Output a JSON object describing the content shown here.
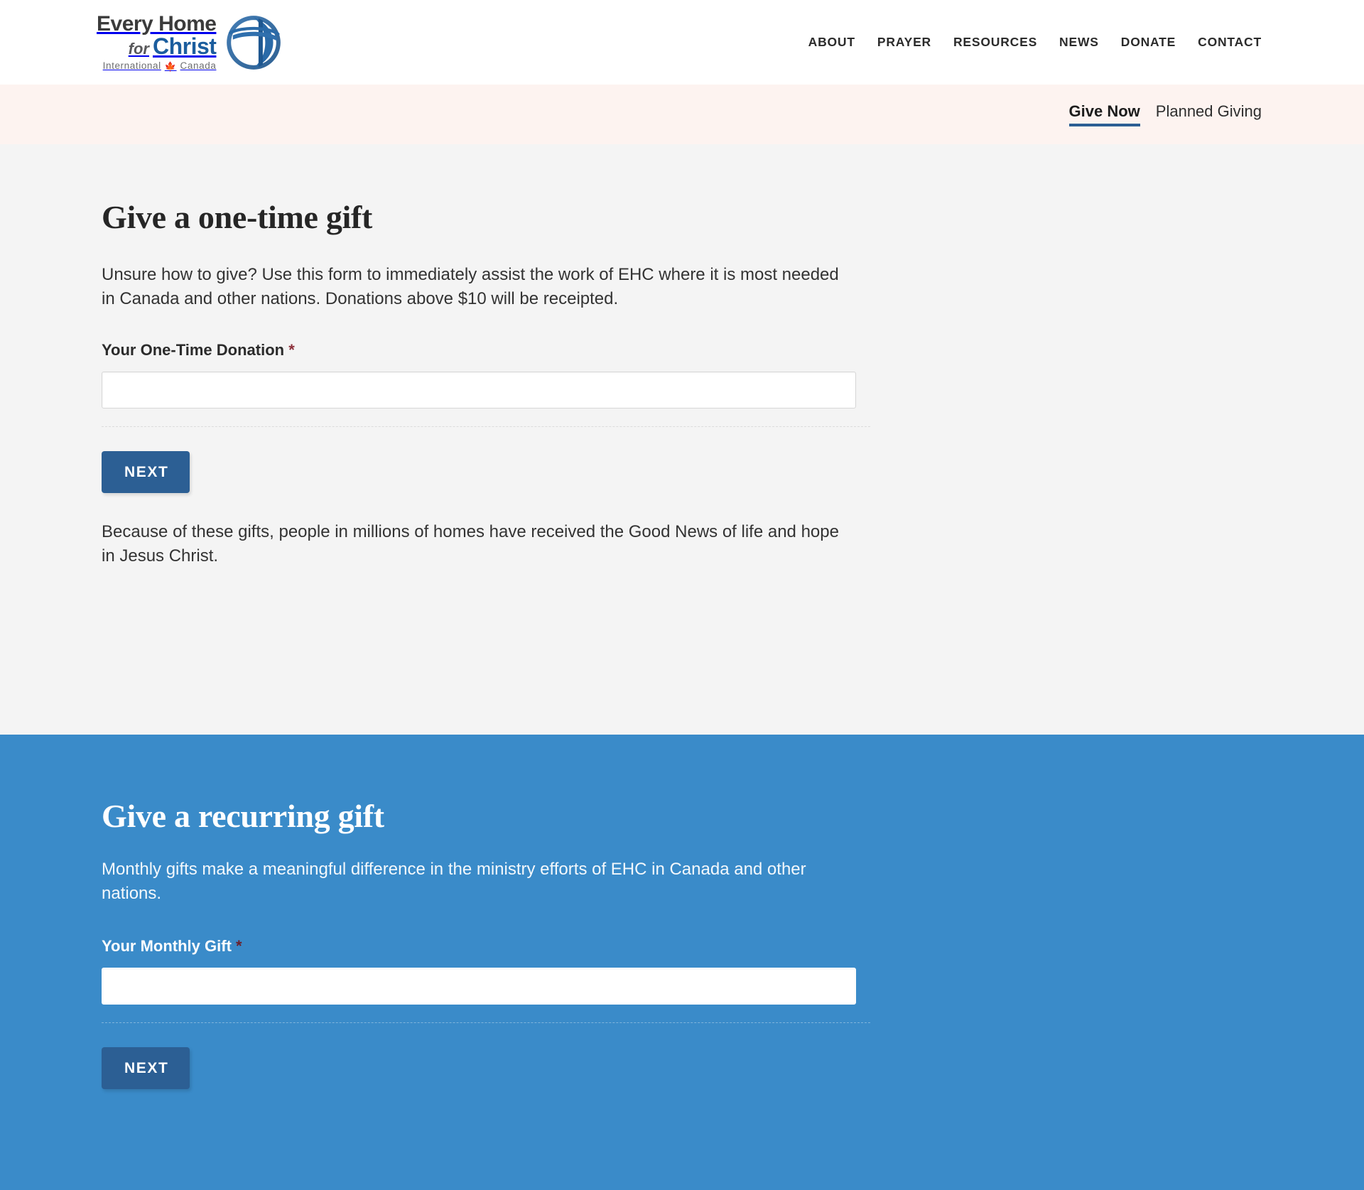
{
  "brand": {
    "logo_line1": "Every Home",
    "logo_for": "for",
    "logo_christ": "Christ",
    "logo_line3_left": "International",
    "logo_line3_right": "Canada",
    "logo_emblem_name": "globe-cross-emblem",
    "color_blue": "#1b5d9e",
    "color_dark": "#3b3b3b"
  },
  "nav": {
    "items": [
      {
        "label": "ABOUT"
      },
      {
        "label": "PRAYER"
      },
      {
        "label": "RESOURCES"
      },
      {
        "label": "NEWS"
      },
      {
        "label": "DONATE"
      },
      {
        "label": "CONTACT"
      }
    ]
  },
  "subnav": {
    "tabs": [
      {
        "label": "Give Now",
        "active": true
      },
      {
        "label": "Planned Giving",
        "active": false
      }
    ],
    "band_color": "#fdf3f0",
    "active_underline_color": "#2c5f94"
  },
  "one_time": {
    "heading": "Give a one-time gift",
    "intro": "Unsure how to give? Use this form to immediately assist the work of EHC where it is most needed in Canada and other nations. Donations above $10 will be receipted.",
    "field_label": "Your One-Time Donation",
    "required_marker": "*",
    "input_value": "",
    "input_placeholder": "",
    "next_label": "NEXT",
    "closing": "Because of these gifts, people in millions of homes have received the Good News of life and hope in Jesus Christ.",
    "background_color": "#f4f4f4",
    "button_color": "#2c5f94"
  },
  "recurring": {
    "heading": "Give a recurring gift",
    "intro": "Monthly gifts make a meaningful difference in the ministry efforts of EHC in Canada and other nations.",
    "field_label": "Your Monthly Gift",
    "required_marker": "*",
    "input_value": "",
    "input_placeholder": "",
    "next_label": "NEXT",
    "background_color": "#3a8bc9",
    "button_color": "#2c5f94"
  }
}
